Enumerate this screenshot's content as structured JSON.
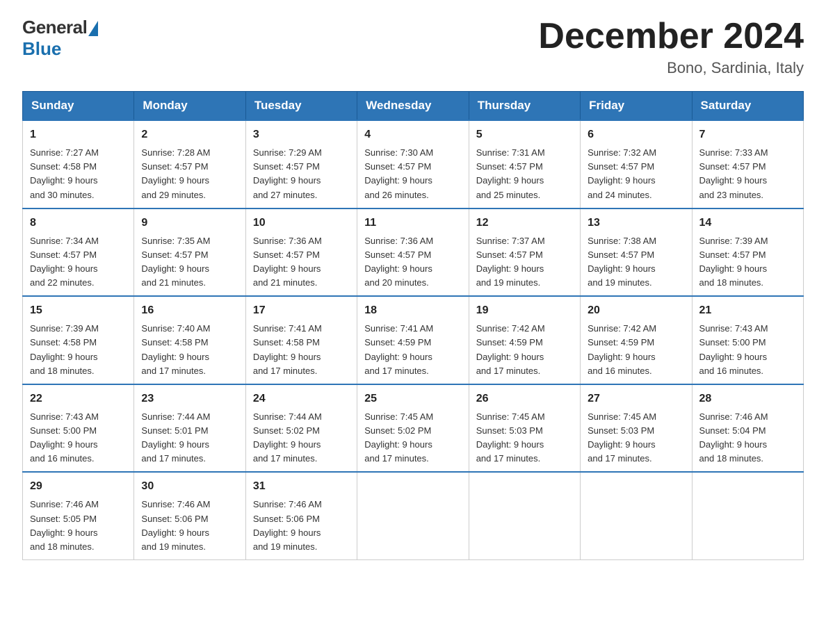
{
  "logo": {
    "general": "General",
    "blue": "Blue"
  },
  "title": "December 2024",
  "location": "Bono, Sardinia, Italy",
  "days_of_week": [
    "Sunday",
    "Monday",
    "Tuesday",
    "Wednesday",
    "Thursday",
    "Friday",
    "Saturday"
  ],
  "weeks": [
    [
      {
        "num": "1",
        "sunrise": "7:27 AM",
        "sunset": "4:58 PM",
        "daylight": "9 hours and 30 minutes."
      },
      {
        "num": "2",
        "sunrise": "7:28 AM",
        "sunset": "4:57 PM",
        "daylight": "9 hours and 29 minutes."
      },
      {
        "num": "3",
        "sunrise": "7:29 AM",
        "sunset": "4:57 PM",
        "daylight": "9 hours and 27 minutes."
      },
      {
        "num": "4",
        "sunrise": "7:30 AM",
        "sunset": "4:57 PM",
        "daylight": "9 hours and 26 minutes."
      },
      {
        "num": "5",
        "sunrise": "7:31 AM",
        "sunset": "4:57 PM",
        "daylight": "9 hours and 25 minutes."
      },
      {
        "num": "6",
        "sunrise": "7:32 AM",
        "sunset": "4:57 PM",
        "daylight": "9 hours and 24 minutes."
      },
      {
        "num": "7",
        "sunrise": "7:33 AM",
        "sunset": "4:57 PM",
        "daylight": "9 hours and 23 minutes."
      }
    ],
    [
      {
        "num": "8",
        "sunrise": "7:34 AM",
        "sunset": "4:57 PM",
        "daylight": "9 hours and 22 minutes."
      },
      {
        "num": "9",
        "sunrise": "7:35 AM",
        "sunset": "4:57 PM",
        "daylight": "9 hours and 21 minutes."
      },
      {
        "num": "10",
        "sunrise": "7:36 AM",
        "sunset": "4:57 PM",
        "daylight": "9 hours and 21 minutes."
      },
      {
        "num": "11",
        "sunrise": "7:36 AM",
        "sunset": "4:57 PM",
        "daylight": "9 hours and 20 minutes."
      },
      {
        "num": "12",
        "sunrise": "7:37 AM",
        "sunset": "4:57 PM",
        "daylight": "9 hours and 19 minutes."
      },
      {
        "num": "13",
        "sunrise": "7:38 AM",
        "sunset": "4:57 PM",
        "daylight": "9 hours and 19 minutes."
      },
      {
        "num": "14",
        "sunrise": "7:39 AM",
        "sunset": "4:57 PM",
        "daylight": "9 hours and 18 minutes."
      }
    ],
    [
      {
        "num": "15",
        "sunrise": "7:39 AM",
        "sunset": "4:58 PM",
        "daylight": "9 hours and 18 minutes."
      },
      {
        "num": "16",
        "sunrise": "7:40 AM",
        "sunset": "4:58 PM",
        "daylight": "9 hours and 17 minutes."
      },
      {
        "num": "17",
        "sunrise": "7:41 AM",
        "sunset": "4:58 PM",
        "daylight": "9 hours and 17 minutes."
      },
      {
        "num": "18",
        "sunrise": "7:41 AM",
        "sunset": "4:59 PM",
        "daylight": "9 hours and 17 minutes."
      },
      {
        "num": "19",
        "sunrise": "7:42 AM",
        "sunset": "4:59 PM",
        "daylight": "9 hours and 17 minutes."
      },
      {
        "num": "20",
        "sunrise": "7:42 AM",
        "sunset": "4:59 PM",
        "daylight": "9 hours and 16 minutes."
      },
      {
        "num": "21",
        "sunrise": "7:43 AM",
        "sunset": "5:00 PM",
        "daylight": "9 hours and 16 minutes."
      }
    ],
    [
      {
        "num": "22",
        "sunrise": "7:43 AM",
        "sunset": "5:00 PM",
        "daylight": "9 hours and 16 minutes."
      },
      {
        "num": "23",
        "sunrise": "7:44 AM",
        "sunset": "5:01 PM",
        "daylight": "9 hours and 17 minutes."
      },
      {
        "num": "24",
        "sunrise": "7:44 AM",
        "sunset": "5:02 PM",
        "daylight": "9 hours and 17 minutes."
      },
      {
        "num": "25",
        "sunrise": "7:45 AM",
        "sunset": "5:02 PM",
        "daylight": "9 hours and 17 minutes."
      },
      {
        "num": "26",
        "sunrise": "7:45 AM",
        "sunset": "5:03 PM",
        "daylight": "9 hours and 17 minutes."
      },
      {
        "num": "27",
        "sunrise": "7:45 AM",
        "sunset": "5:03 PM",
        "daylight": "9 hours and 17 minutes."
      },
      {
        "num": "28",
        "sunrise": "7:46 AM",
        "sunset": "5:04 PM",
        "daylight": "9 hours and 18 minutes."
      }
    ],
    [
      {
        "num": "29",
        "sunrise": "7:46 AM",
        "sunset": "5:05 PM",
        "daylight": "9 hours and 18 minutes."
      },
      {
        "num": "30",
        "sunrise": "7:46 AM",
        "sunset": "5:06 PM",
        "daylight": "9 hours and 19 minutes."
      },
      {
        "num": "31",
        "sunrise": "7:46 AM",
        "sunset": "5:06 PM",
        "daylight": "9 hours and 19 minutes."
      },
      null,
      null,
      null,
      null
    ]
  ],
  "labels": {
    "sunrise": "Sunrise:",
    "sunset": "Sunset:",
    "daylight": "Daylight:"
  }
}
